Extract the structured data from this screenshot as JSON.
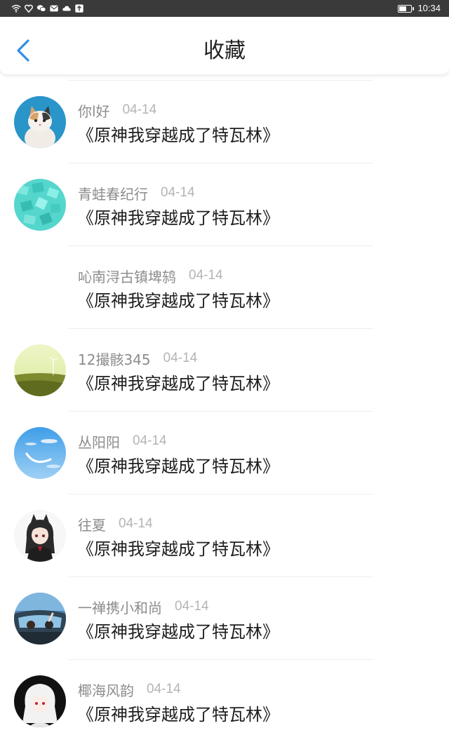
{
  "status_bar": {
    "time": "10:34",
    "icons": [
      "wifi-icon",
      "shield-icon",
      "wechat-icon",
      "mail-icon",
      "cloud-icon",
      "upload-icon"
    ],
    "battery_level": 0.55
  },
  "header": {
    "title": "收藏",
    "back_icon": "chevron-left-icon",
    "accent_color": "#2e8fe6"
  },
  "favorites": [
    {
      "username": "你l好",
      "date": "04-14",
      "book": "《原神我穿越成了特瓦林》",
      "avatar": "cat"
    },
    {
      "username": "青蛙春纪行",
      "date": "04-14",
      "book": "《原神我穿越成了特瓦林》",
      "avatar": "teal-blocks"
    },
    {
      "username": "吣南浔古镇埤鸫",
      "date": "04-14",
      "book": "《原神我穿越成了特瓦林》",
      "avatar": "none"
    },
    {
      "username": "12撮骸345",
      "date": "04-14",
      "book": "《原神我穿越成了特瓦林》",
      "avatar": "field"
    },
    {
      "username": "丛阳阳",
      "date": "04-14",
      "book": "《原神我穿越成了特瓦林》",
      "avatar": "sky"
    },
    {
      "username": "往夏",
      "date": "04-14",
      "book": "《原神我穿越成了特瓦林》",
      "avatar": "anime-girl"
    },
    {
      "username": "一禅携小和尚",
      "date": "04-14",
      "book": "《原神我穿越成了特瓦林》",
      "avatar": "car"
    },
    {
      "username": "椰海风韵",
      "date": "04-14",
      "book": "《原神我穿越成了特瓦林》",
      "avatar": "white-hair"
    }
  ]
}
